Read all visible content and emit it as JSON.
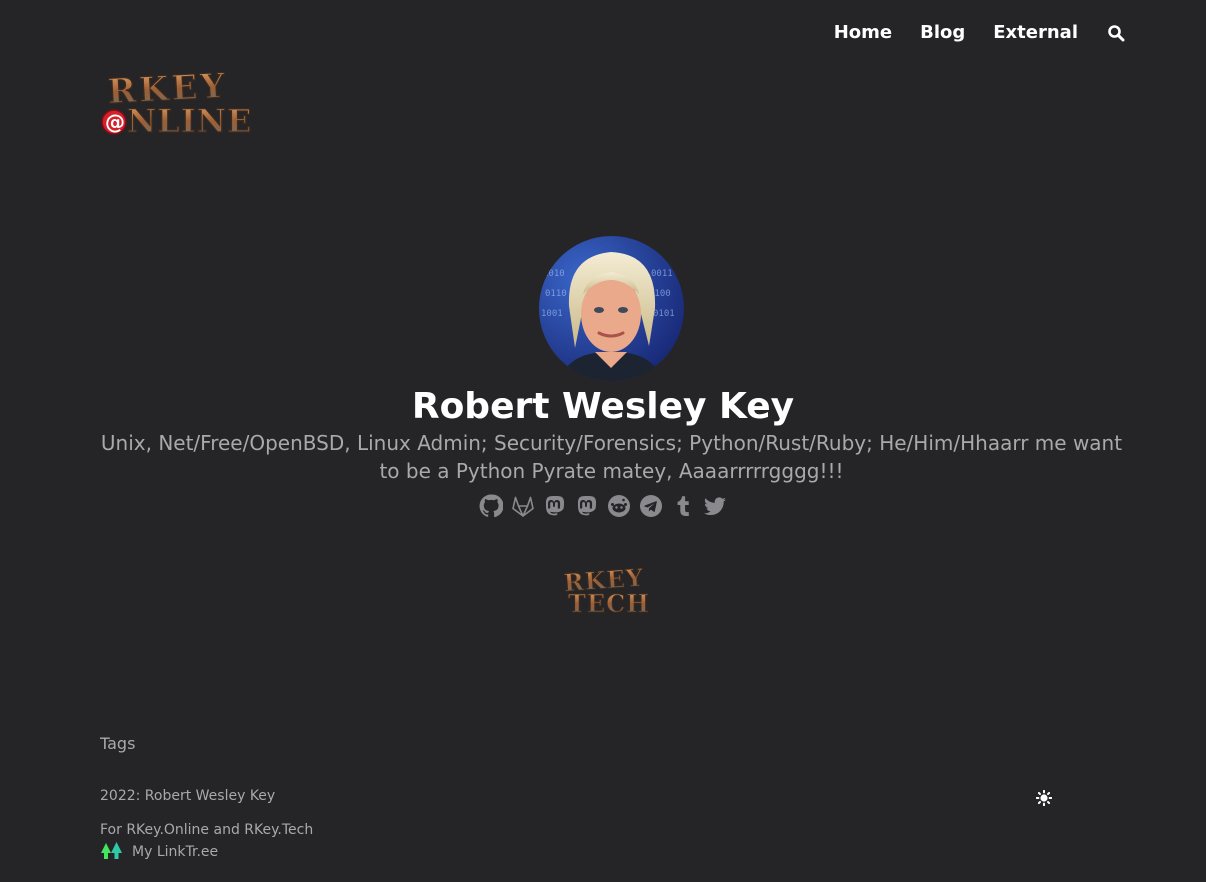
{
  "nav": {
    "items": [
      {
        "label": "Home"
      },
      {
        "label": "Blog"
      },
      {
        "label": "External"
      }
    ]
  },
  "site_logo": {
    "line1": "RKEY",
    "line2": "@NLINE"
  },
  "profile": {
    "name": "Robert Wesley Key",
    "bio": "Unix, Net/Free/OpenBSD, Linux Admin; Security/Forensics; Python/Rust/Ruby; He/Him/Hhaarr me want to be a Python Pyrate matey, Aaaarrrrrgggg!!!",
    "social_icons": [
      "github-icon",
      "gitlab-icon",
      "mastodon-icon",
      "mastodon-icon",
      "reddit-icon",
      "telegram-icon",
      "tumblr-icon",
      "twitter-icon"
    ]
  },
  "tech_logo": {
    "line1": "RKEY",
    "line2": "TECH"
  },
  "footer": {
    "tags_label": "Tags",
    "copyright": "2022: Robert Wesley Key",
    "for_text": "For RKey.Online and RKey.Tech",
    "linktree_label": "My LinkTr.ee"
  },
  "colors": {
    "background": "#252528",
    "muted_text": "#a9a9ad",
    "linktree_green": "#43e55e"
  }
}
